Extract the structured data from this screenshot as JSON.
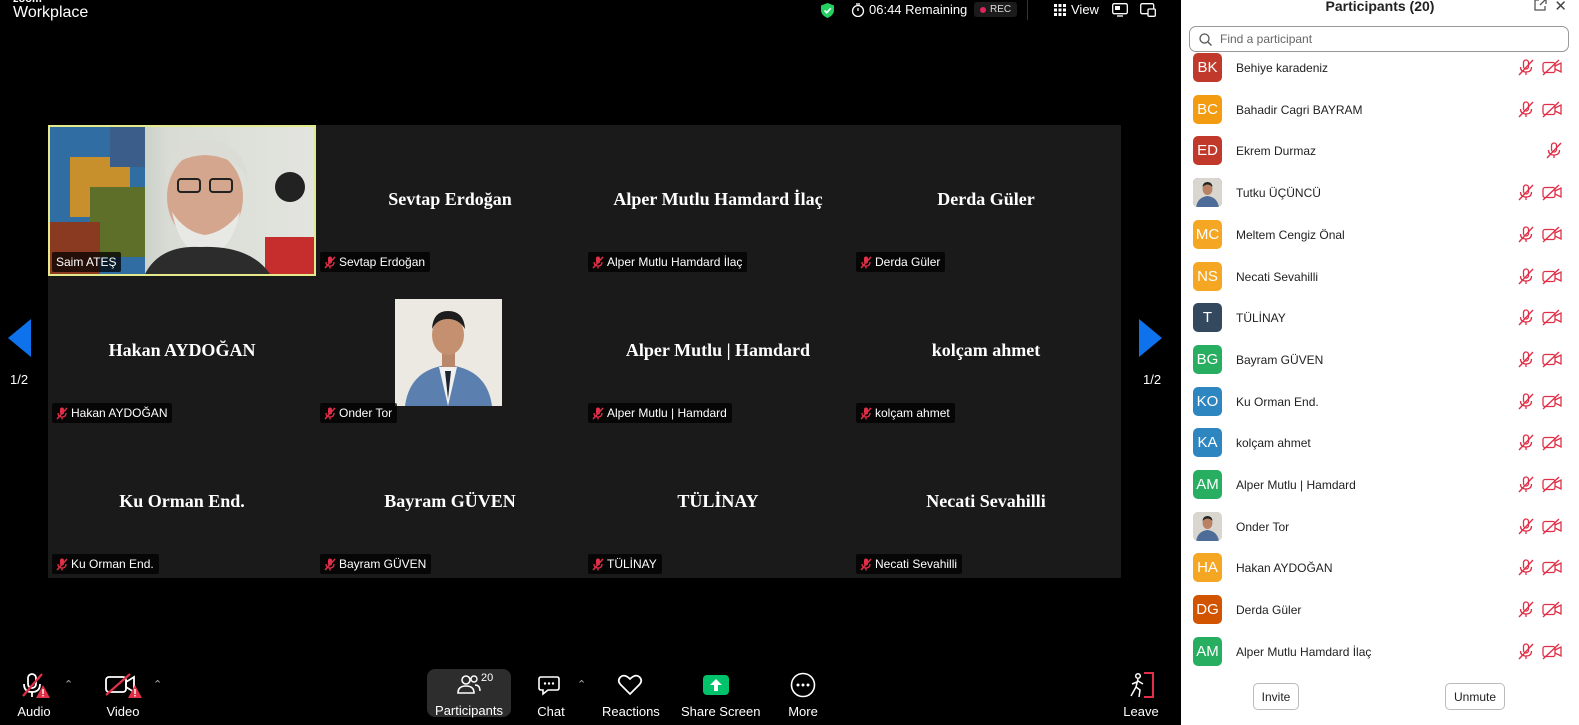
{
  "app": {
    "logo_top": "zoom",
    "logo_bottom": "Workplace"
  },
  "topbar": {
    "remaining": "06:44 Remaining",
    "rec": "REC",
    "view": "View"
  },
  "colors": {
    "accent_blue": "#0e72ed",
    "muted_red": "#e02f47",
    "share_green": "#00c26a",
    "active_border": "#e4e98b"
  },
  "gallery": {
    "page_left": "1/2",
    "page_right": "1/2",
    "tiles": [
      {
        "big": "",
        "tag": "Saim ATEŞ",
        "muted": false,
        "video": "person"
      },
      {
        "big": "Sevtap Erdoğan",
        "tag": "Sevtap Erdoğan",
        "muted": true
      },
      {
        "big": "Alper Mutlu Hamdard İlaç",
        "tag": "Alper Mutlu Hamdard İlaç",
        "muted": true
      },
      {
        "big": "Derda Güler",
        "tag": "Derda Güler",
        "muted": true
      },
      {
        "big": "Hakan AYDOĞAN",
        "tag": "Hakan AYDOĞAN",
        "muted": true
      },
      {
        "big": "",
        "tag": "Onder Tor",
        "muted": true,
        "video": "photo"
      },
      {
        "big": "Alper Mutlu | Hamdard",
        "tag": "Alper Mutlu | Hamdard",
        "muted": true
      },
      {
        "big": "kolçam ahmet",
        "tag": "kolçam ahmet",
        "muted": true
      },
      {
        "big": "Ku Orman End.",
        "tag": "Ku Orman End.",
        "muted": true
      },
      {
        "big": "Bayram GÜVEN",
        "tag": "Bayram GÜVEN",
        "muted": true
      },
      {
        "big": "TÜLİNAY",
        "tag": "TÜLİNAY",
        "muted": true
      },
      {
        "big": "Necati Sevahilli",
        "tag": "Necati Sevahilli",
        "muted": true
      }
    ]
  },
  "toolbar": {
    "audio": "Audio",
    "video": "Video",
    "participants": "Participants",
    "participants_count": "20",
    "chat": "Chat",
    "reactions": "Reactions",
    "share": "Share Screen",
    "more": "More",
    "leave": "Leave"
  },
  "panel": {
    "title": "Participants (20)",
    "search_placeholder": "Find a participant",
    "participants": [
      {
        "initials": "BK",
        "name": "Behiye karadeniz",
        "color": "#c0392b",
        "video_icon": true
      },
      {
        "initials": "BC",
        "name": "Bahadir Cagri BAYRAM",
        "color": "#f39c12",
        "video_icon": true
      },
      {
        "initials": "ED",
        "name": "Ekrem Durmaz",
        "color": "#c0392b",
        "video_icon": false
      },
      {
        "initials": "",
        "name": "Tutku ÜÇÜNCÜ",
        "color": "#3d4a55",
        "photo": true,
        "video_icon": true
      },
      {
        "initials": "MC",
        "name": "Meltem Cengiz Önal",
        "color": "#f5a623",
        "video_icon": true
      },
      {
        "initials": "NS",
        "name": "Necati Sevahilli",
        "color": "#f5a623",
        "video_icon": true
      },
      {
        "initials": "T",
        "name": "TÜLİNAY",
        "color": "#34495e",
        "video_icon": true
      },
      {
        "initials": "BG",
        "name": "Bayram GÜVEN",
        "color": "#27ae60",
        "video_icon": true
      },
      {
        "initials": "KO",
        "name": "Ku Orman End.",
        "color": "#2e86c1",
        "video_icon": true
      },
      {
        "initials": "KA",
        "name": "kolçam ahmet",
        "color": "#2e86c1",
        "video_icon": true
      },
      {
        "initials": "AM",
        "name": "Alper Mutlu | Hamdard",
        "color": "#27ae60",
        "video_icon": true
      },
      {
        "initials": "",
        "name": "Onder Tor",
        "color": "#d5d3cf",
        "photo": true,
        "video_icon": true
      },
      {
        "initials": "HA",
        "name": "Hakan AYDOĞAN",
        "color": "#f5a623",
        "video_icon": true
      },
      {
        "initials": "DG",
        "name": "Derda Güler",
        "color": "#d35400",
        "video_icon": true
      },
      {
        "initials": "AM",
        "name": "Alper Mutlu Hamdard İlaç",
        "color": "#27ae60",
        "video_icon": true
      }
    ],
    "invite": "Invite",
    "unmute": "Unmute"
  }
}
